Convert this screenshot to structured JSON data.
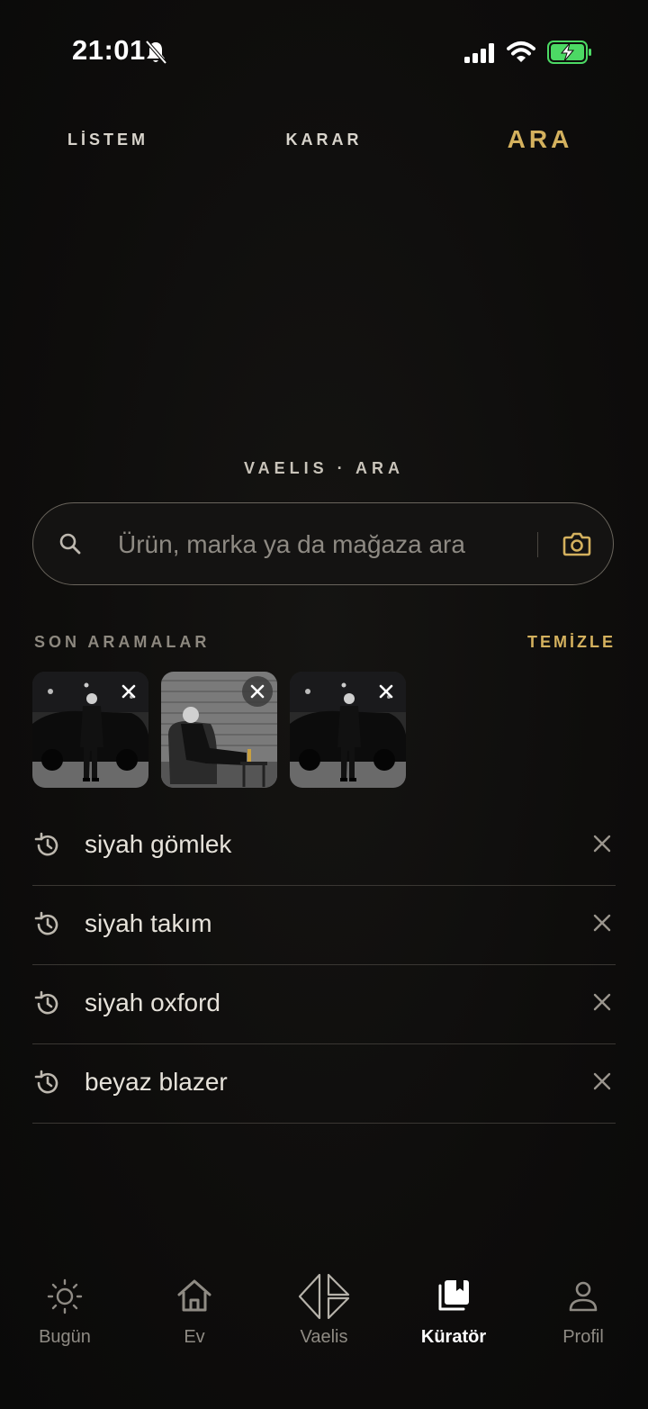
{
  "status_bar": {
    "time": "21:01"
  },
  "top_tabs": [
    {
      "label": "LİSTEM",
      "active": false
    },
    {
      "label": "KARAR",
      "active": false
    },
    {
      "label": "ARA",
      "active": true
    }
  ],
  "search": {
    "section_title": "VAELIS · ARA",
    "placeholder": "Ürün, marka ya da mağaza ara",
    "value": ""
  },
  "recent": {
    "header": "SON ARAMALAR",
    "clear_label": "TEMİZLE",
    "image_searches": [
      {
        "name": "man-by-car-photo"
      },
      {
        "name": "man-seated-photo"
      },
      {
        "name": "man-by-car-photo"
      }
    ],
    "text_searches": [
      {
        "label": "siyah gömlek"
      },
      {
        "label": "siyah takım"
      },
      {
        "label": "siyah oxford"
      },
      {
        "label": "beyaz blazer"
      }
    ]
  },
  "bottom_nav": [
    {
      "label": "Bugün",
      "icon": "sun-icon",
      "active": false
    },
    {
      "label": "Ev",
      "icon": "home-icon",
      "active": false
    },
    {
      "label": "Vaelis",
      "icon": "vaelis-logo-icon",
      "active": false
    },
    {
      "label": "Küratör",
      "icon": "collection-icon",
      "active": true
    },
    {
      "label": "Profil",
      "icon": "person-icon",
      "active": false
    }
  ],
  "colors": {
    "accent": "#d4b15e",
    "background": "#0f0e0d",
    "battery": "#4cd964"
  }
}
